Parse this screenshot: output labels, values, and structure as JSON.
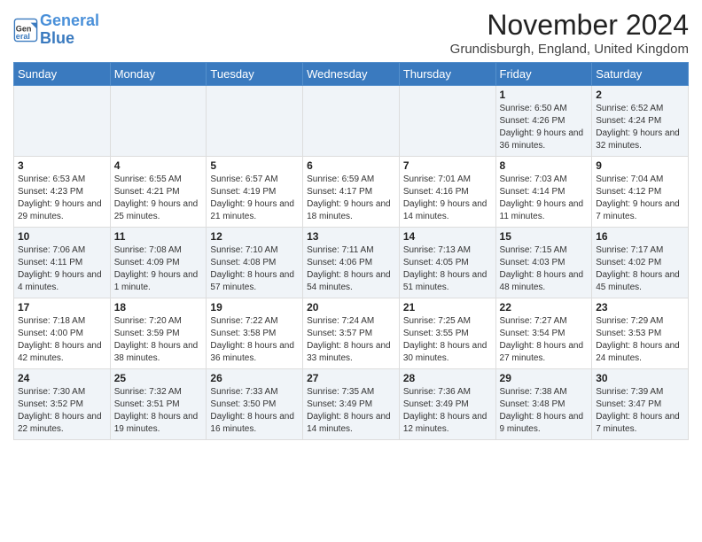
{
  "header": {
    "logo_line1": "General",
    "logo_line2": "Blue",
    "month_title": "November 2024",
    "location": "Grundisburgh, England, United Kingdom"
  },
  "days_of_week": [
    "Sunday",
    "Monday",
    "Tuesday",
    "Wednesday",
    "Thursday",
    "Friday",
    "Saturday"
  ],
  "weeks": [
    [
      {
        "day": "",
        "info": ""
      },
      {
        "day": "",
        "info": ""
      },
      {
        "day": "",
        "info": ""
      },
      {
        "day": "",
        "info": ""
      },
      {
        "day": "",
        "info": ""
      },
      {
        "day": "1",
        "info": "Sunrise: 6:50 AM\nSunset: 4:26 PM\nDaylight: 9 hours and 36 minutes."
      },
      {
        "day": "2",
        "info": "Sunrise: 6:52 AM\nSunset: 4:24 PM\nDaylight: 9 hours and 32 minutes."
      }
    ],
    [
      {
        "day": "3",
        "info": "Sunrise: 6:53 AM\nSunset: 4:23 PM\nDaylight: 9 hours and 29 minutes."
      },
      {
        "day": "4",
        "info": "Sunrise: 6:55 AM\nSunset: 4:21 PM\nDaylight: 9 hours and 25 minutes."
      },
      {
        "day": "5",
        "info": "Sunrise: 6:57 AM\nSunset: 4:19 PM\nDaylight: 9 hours and 21 minutes."
      },
      {
        "day": "6",
        "info": "Sunrise: 6:59 AM\nSunset: 4:17 PM\nDaylight: 9 hours and 18 minutes."
      },
      {
        "day": "7",
        "info": "Sunrise: 7:01 AM\nSunset: 4:16 PM\nDaylight: 9 hours and 14 minutes."
      },
      {
        "day": "8",
        "info": "Sunrise: 7:03 AM\nSunset: 4:14 PM\nDaylight: 9 hours and 11 minutes."
      },
      {
        "day": "9",
        "info": "Sunrise: 7:04 AM\nSunset: 4:12 PM\nDaylight: 9 hours and 7 minutes."
      }
    ],
    [
      {
        "day": "10",
        "info": "Sunrise: 7:06 AM\nSunset: 4:11 PM\nDaylight: 9 hours and 4 minutes."
      },
      {
        "day": "11",
        "info": "Sunrise: 7:08 AM\nSunset: 4:09 PM\nDaylight: 9 hours and 1 minute."
      },
      {
        "day": "12",
        "info": "Sunrise: 7:10 AM\nSunset: 4:08 PM\nDaylight: 8 hours and 57 minutes."
      },
      {
        "day": "13",
        "info": "Sunrise: 7:11 AM\nSunset: 4:06 PM\nDaylight: 8 hours and 54 minutes."
      },
      {
        "day": "14",
        "info": "Sunrise: 7:13 AM\nSunset: 4:05 PM\nDaylight: 8 hours and 51 minutes."
      },
      {
        "day": "15",
        "info": "Sunrise: 7:15 AM\nSunset: 4:03 PM\nDaylight: 8 hours and 48 minutes."
      },
      {
        "day": "16",
        "info": "Sunrise: 7:17 AM\nSunset: 4:02 PM\nDaylight: 8 hours and 45 minutes."
      }
    ],
    [
      {
        "day": "17",
        "info": "Sunrise: 7:18 AM\nSunset: 4:00 PM\nDaylight: 8 hours and 42 minutes."
      },
      {
        "day": "18",
        "info": "Sunrise: 7:20 AM\nSunset: 3:59 PM\nDaylight: 8 hours and 38 minutes."
      },
      {
        "day": "19",
        "info": "Sunrise: 7:22 AM\nSunset: 3:58 PM\nDaylight: 8 hours and 36 minutes."
      },
      {
        "day": "20",
        "info": "Sunrise: 7:24 AM\nSunset: 3:57 PM\nDaylight: 8 hours and 33 minutes."
      },
      {
        "day": "21",
        "info": "Sunrise: 7:25 AM\nSunset: 3:55 PM\nDaylight: 8 hours and 30 minutes."
      },
      {
        "day": "22",
        "info": "Sunrise: 7:27 AM\nSunset: 3:54 PM\nDaylight: 8 hours and 27 minutes."
      },
      {
        "day": "23",
        "info": "Sunrise: 7:29 AM\nSunset: 3:53 PM\nDaylight: 8 hours and 24 minutes."
      }
    ],
    [
      {
        "day": "24",
        "info": "Sunrise: 7:30 AM\nSunset: 3:52 PM\nDaylight: 8 hours and 22 minutes."
      },
      {
        "day": "25",
        "info": "Sunrise: 7:32 AM\nSunset: 3:51 PM\nDaylight: 8 hours and 19 minutes."
      },
      {
        "day": "26",
        "info": "Sunrise: 7:33 AM\nSunset: 3:50 PM\nDaylight: 8 hours and 16 minutes."
      },
      {
        "day": "27",
        "info": "Sunrise: 7:35 AM\nSunset: 3:49 PM\nDaylight: 8 hours and 14 minutes."
      },
      {
        "day": "28",
        "info": "Sunrise: 7:36 AM\nSunset: 3:49 PM\nDaylight: 8 hours and 12 minutes."
      },
      {
        "day": "29",
        "info": "Sunrise: 7:38 AM\nSunset: 3:48 PM\nDaylight: 8 hours and 9 minutes."
      },
      {
        "day": "30",
        "info": "Sunrise: 7:39 AM\nSunset: 3:47 PM\nDaylight: 8 hours and 7 minutes."
      }
    ]
  ]
}
